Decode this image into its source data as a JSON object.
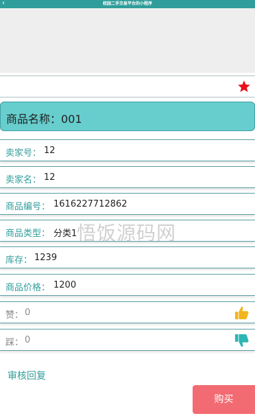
{
  "header": {
    "back_icon": "‹",
    "title": "校园二手交易平台的小程序"
  },
  "product": {
    "name_label": "商品名称：",
    "name_value": "001"
  },
  "fields": {
    "seller_id": {
      "label": "卖家号：",
      "value": "12"
    },
    "seller_name": {
      "label": "卖家名：",
      "value": "12"
    },
    "product_code": {
      "label": "商品编号：",
      "value": "1616227712862"
    },
    "product_type": {
      "label": "商品类型：",
      "value": "分类1"
    },
    "stock": {
      "label": "库存：",
      "value": "1239"
    },
    "price": {
      "label": "商品价格：",
      "value": "1200"
    },
    "likes": {
      "label": "赞：",
      "value": "0"
    },
    "dislikes": {
      "label": "踩：",
      "value": "0"
    }
  },
  "review_label": "审核回复",
  "buy_label": "购买",
  "watermark": "悟饭源码网",
  "colors": {
    "accent": "#2f9e9b",
    "name_bg": "#67cdcd",
    "buy_bg": "#f26b72",
    "star": "#e8101a",
    "thumb_up": "#f2b51e",
    "thumb_down": "#2cb5b3"
  },
  "icons": {
    "favorite": "star-icon",
    "like": "thumbs-up-icon",
    "dislike": "thumbs-down-icon"
  }
}
